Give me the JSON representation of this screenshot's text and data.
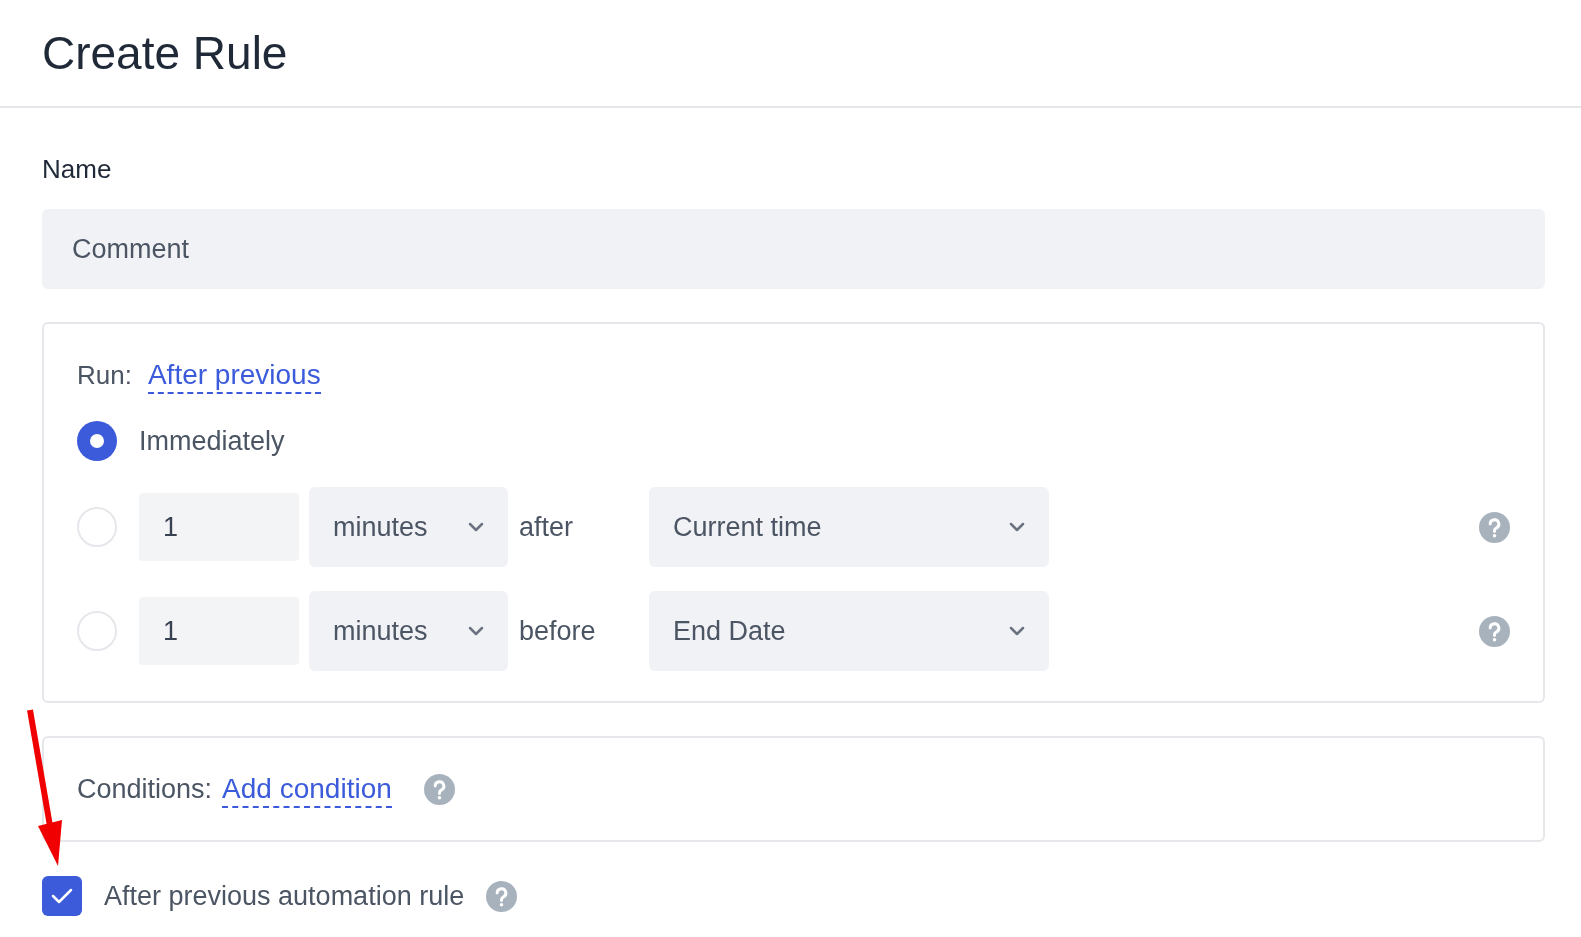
{
  "title": "Create Rule",
  "name_field": {
    "label": "Name",
    "value": "Comment"
  },
  "run": {
    "label": "Run:",
    "mode_link": "After previous",
    "options": [
      {
        "kind": "plain",
        "label": "Immediately",
        "selected": true
      },
      {
        "kind": "offset",
        "amount": "1",
        "unit": "minutes",
        "relation": "after",
        "anchor": "Current time",
        "selected": false
      },
      {
        "kind": "offset",
        "amount": "1",
        "unit": "minutes",
        "relation": "before",
        "anchor": "End Date",
        "selected": false
      }
    ]
  },
  "conditions": {
    "label": "Conditions:",
    "link": "Add condition"
  },
  "after_previous": {
    "label": "After previous automation rule",
    "checked": true
  }
}
